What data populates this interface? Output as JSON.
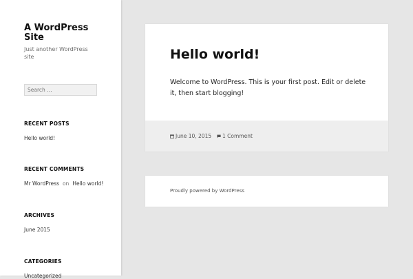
{
  "site": {
    "title": "A WordPress Site",
    "description": "Just another WordPress site"
  },
  "search": {
    "placeholder": "Search …"
  },
  "widgets": {
    "recent_posts": {
      "title": "RECENT POSTS",
      "items": [
        "Hello world!"
      ]
    },
    "recent_comments": {
      "title": "RECENT COMMENTS",
      "author": "Mr WordPress",
      "on": "on",
      "post": "Hello world!"
    },
    "archives": {
      "title": "ARCHIVES",
      "items": [
        "June 2015"
      ]
    },
    "categories": {
      "title": "CATEGORIES",
      "items": [
        "Uncategorized"
      ]
    }
  },
  "post": {
    "title": "Hello world!",
    "content": "Welcome to WordPress. This is your first post. Edit or delete it, then start blogging!",
    "date": "June 10, 2015",
    "comments": "1 Comment"
  },
  "footer": {
    "powered": "Proudly powered by WordPress"
  },
  "colors": {
    "page_bg": "#e6e6e6",
    "panel_bg": "#ffffff",
    "post_footer_bg": "#eeeeee",
    "text": "#333333"
  }
}
